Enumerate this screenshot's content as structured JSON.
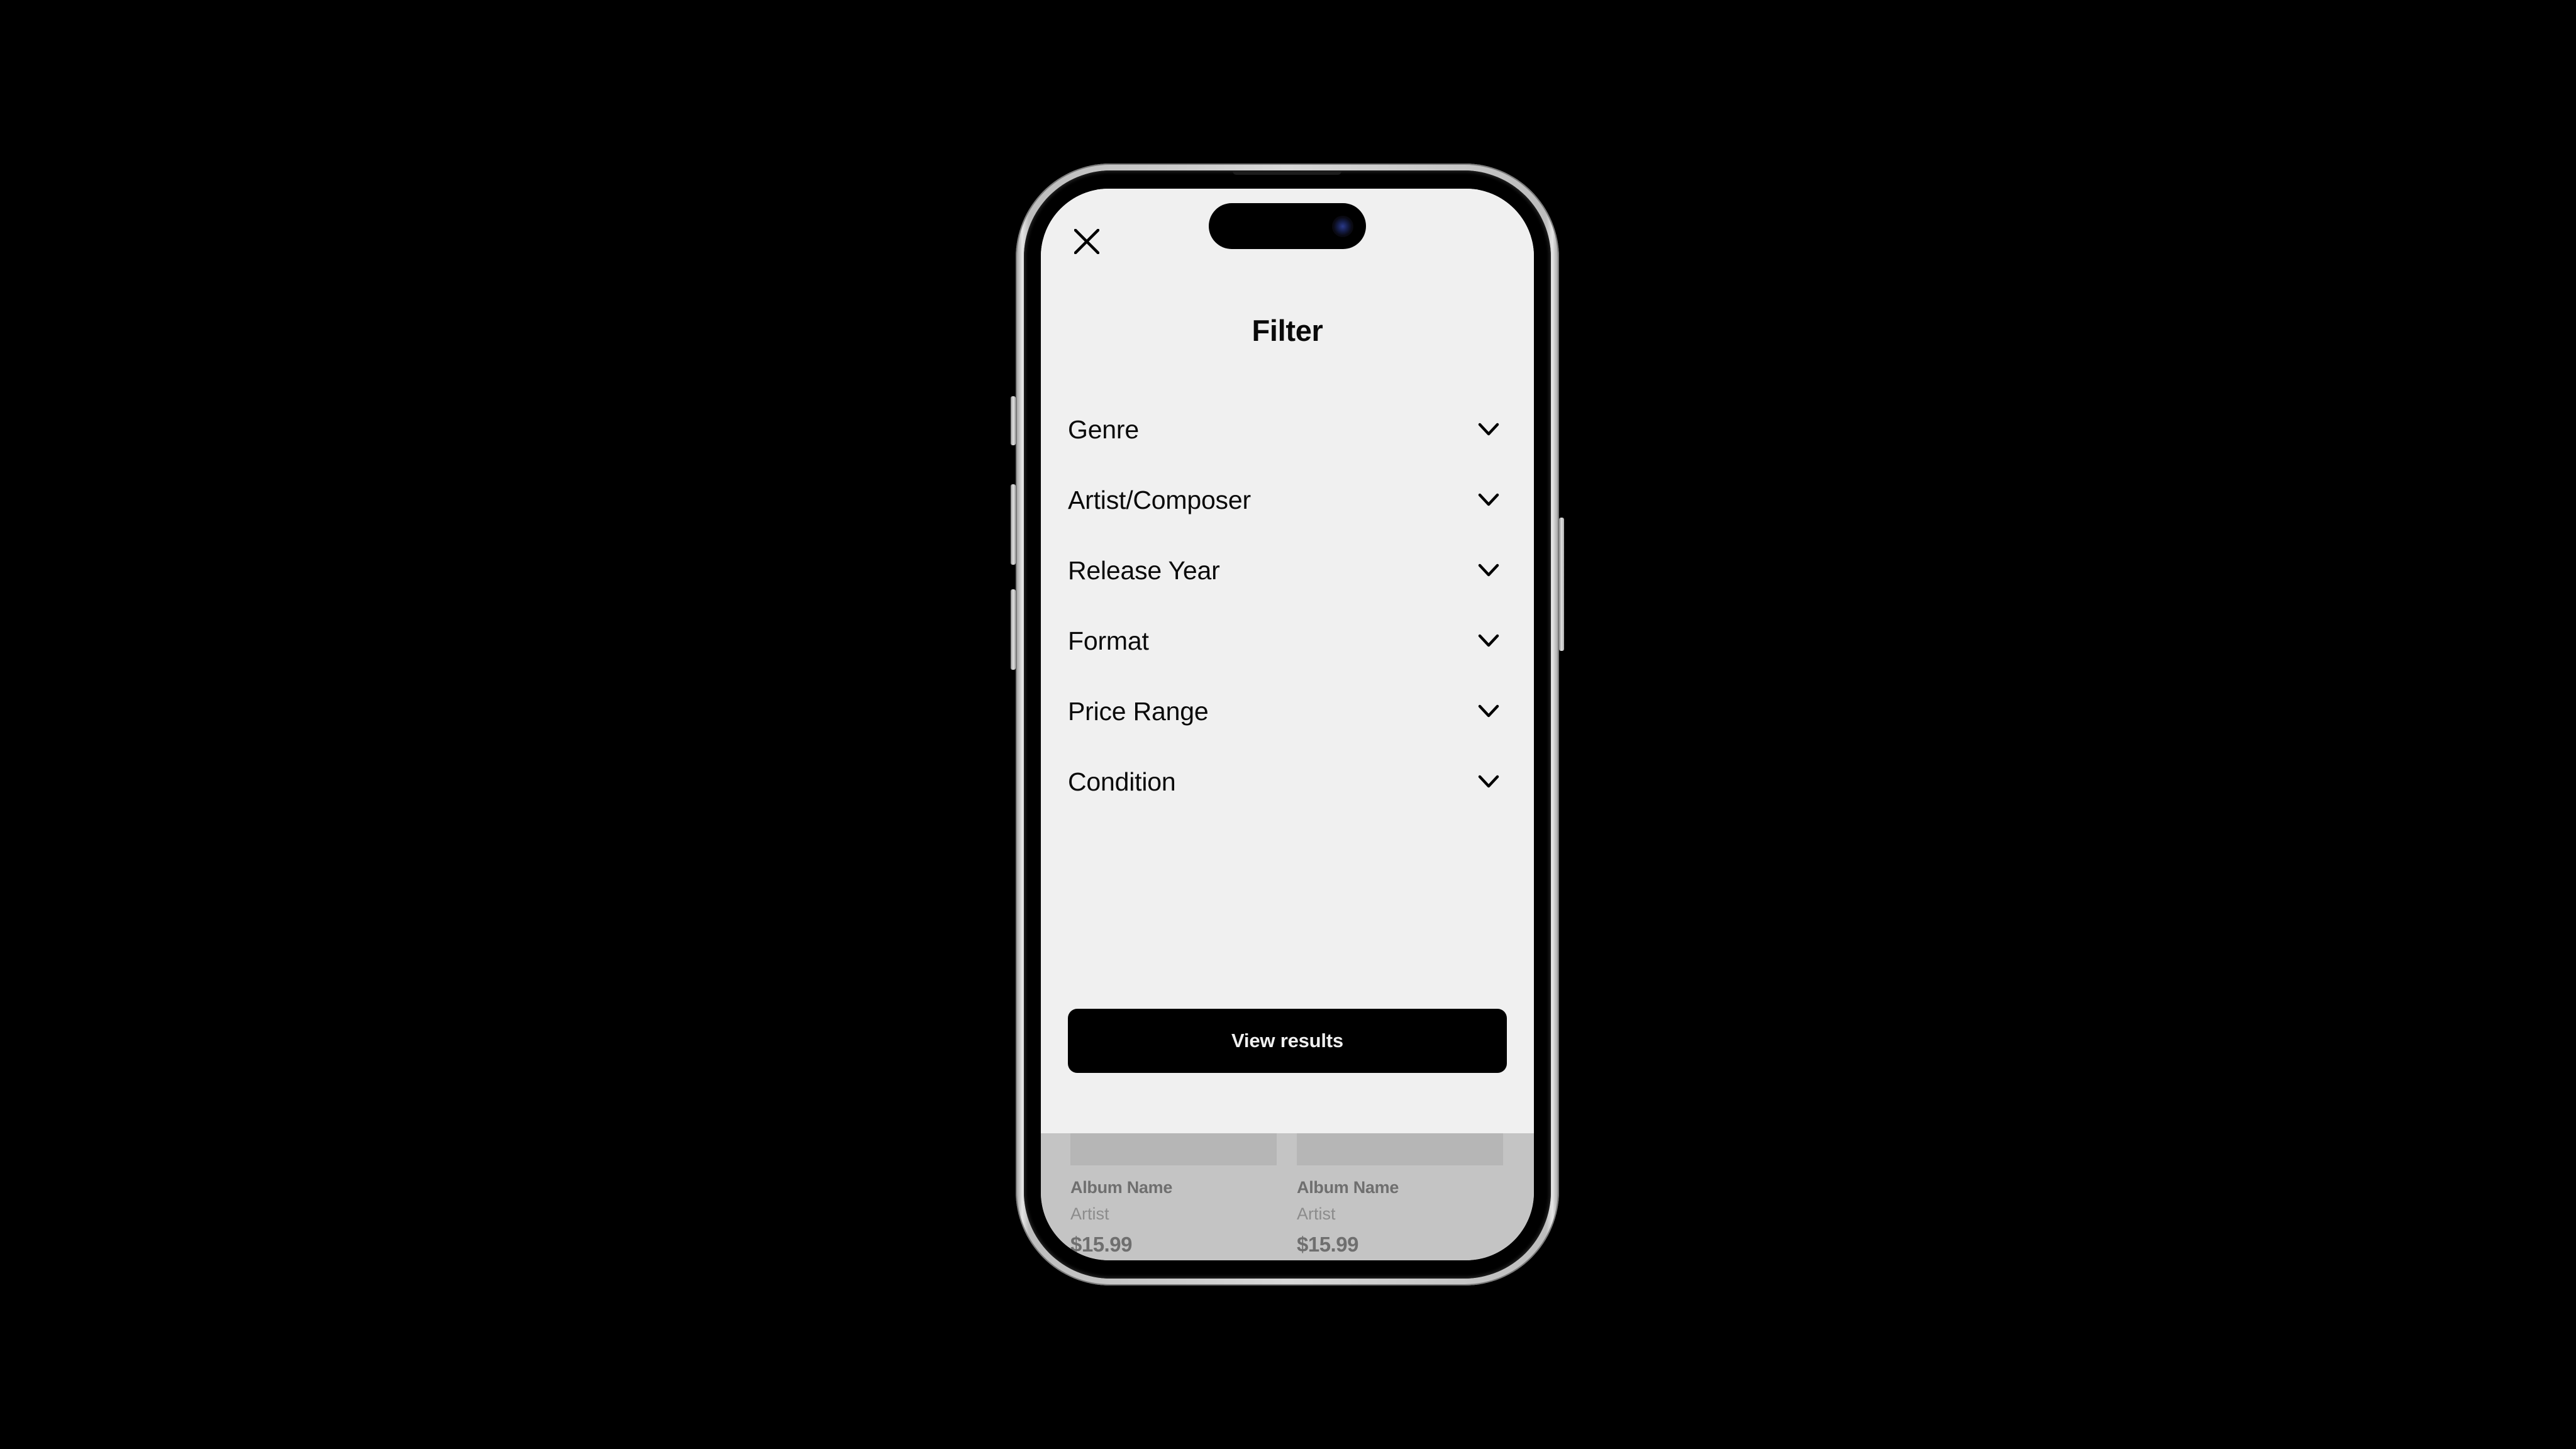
{
  "device": {
    "type": "phone",
    "frame_color": "#d8d8d8"
  },
  "sheet": {
    "title": "Filter",
    "close_icon": "close-icon",
    "background": "#f0f0f0",
    "filters": [
      {
        "label": "Genre",
        "icon": "chevron-down-icon"
      },
      {
        "label": "Artist/Composer",
        "icon": "chevron-down-icon"
      },
      {
        "label": "Release Year",
        "icon": "chevron-down-icon"
      },
      {
        "label": "Format",
        "icon": "chevron-down-icon"
      },
      {
        "label": "Price Range",
        "icon": "chevron-down-icon"
      },
      {
        "label": "Condition",
        "icon": "chevron-down-icon"
      }
    ],
    "primary_button": {
      "label": "View results",
      "background": "#000000",
      "text_color": "#f0f0f0"
    }
  },
  "background_content": {
    "overlay_color": "#c4c4c4",
    "albums": [
      {
        "name": "Album Name",
        "artist": "Artist",
        "price": "$15.99"
      },
      {
        "name": "Album Name",
        "artist": "Artist",
        "price": "$15.99"
      }
    ]
  }
}
